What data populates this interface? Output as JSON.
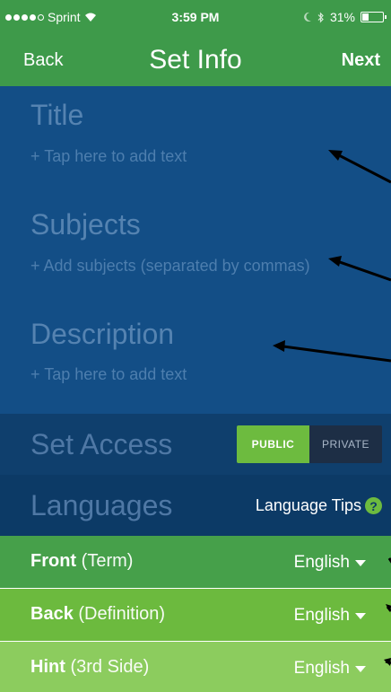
{
  "status": {
    "carrier": "Sprint",
    "time": "3:59 PM",
    "battery": "31%",
    "battery_fraction": 0.31
  },
  "nav": {
    "back_label": "Back",
    "title": "Set Info",
    "next_label": "Next"
  },
  "fields": {
    "title": {
      "label": "Title",
      "placeholder": "+ Tap here to add text"
    },
    "subjects": {
      "label": "Subjects",
      "placeholder": "+ Add subjects (separated by commas)"
    },
    "description": {
      "label": "Description",
      "placeholder": "+ Tap here to add text"
    }
  },
  "access": {
    "label": "Set Access",
    "options": [
      "PUBLIC",
      "PRIVATE"
    ],
    "selected": "PUBLIC"
  },
  "languages": {
    "label": "Languages",
    "tips_label": "Language Tips",
    "sides": [
      {
        "name": "Front",
        "detail": "(Term)",
        "language": "English"
      },
      {
        "name": "Back",
        "detail": "(Definition)",
        "language": "English"
      },
      {
        "name": "Hint",
        "detail": "(3rd Side)",
        "language": "English"
      }
    ]
  },
  "colors": {
    "brand_green": "#3e9a4a",
    "form_blue": "#134e86",
    "accent_green": "#6dbb3f"
  },
  "icons": [
    "wifi-icon",
    "moon-icon",
    "bluetooth-icon",
    "battery-icon",
    "help-icon",
    "chevron-down-icon"
  ]
}
